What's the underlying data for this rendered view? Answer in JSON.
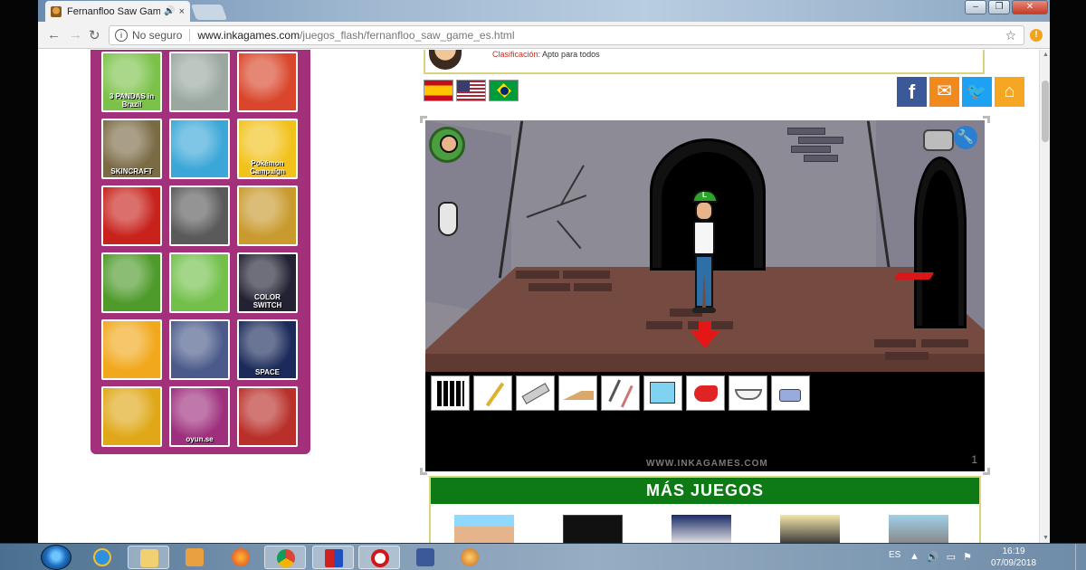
{
  "browser": {
    "tab_title": "Fernanfloo Saw Game",
    "tab_speaker": "🔊",
    "tab_close": "×",
    "security_label": "No seguro",
    "url_host": "www.inkagames.com",
    "url_path": "/juegos_flash/fernanfloo_saw_game_es.html",
    "ext_badge": "!"
  },
  "sidebar_games": [
    {
      "label": "3 PANDAS in Brazil",
      "color": "#7cc24a"
    },
    {
      "label": "",
      "color": "#9aa8a0"
    },
    {
      "label": "",
      "color": "#d9462b"
    },
    {
      "label": "SKINCRAFT",
      "color": "#7b6b45"
    },
    {
      "label": "",
      "color": "#3aa7d8"
    },
    {
      "label": "Pokémon Campaign",
      "color": "#f2c21c"
    },
    {
      "label": "",
      "color": "#c8221c"
    },
    {
      "label": "",
      "color": "#5a5a5a"
    },
    {
      "label": "",
      "color": "#c99a2e"
    },
    {
      "label": "",
      "color": "#4e9a2a"
    },
    {
      "label": "",
      "color": "#72c04a"
    },
    {
      "label": "COLOR SWITCH",
      "color": "#222233"
    },
    {
      "label": "",
      "color": "#f2a81c"
    },
    {
      "label": "",
      "color": "#4a5a8a"
    },
    {
      "label": "SPACE",
      "color": "#1b2a5a"
    },
    {
      "label": "",
      "color": "#e0a818"
    },
    {
      "label": "oyun.se",
      "color": "#9e2f7d"
    },
    {
      "label": "",
      "color": "#b9302a"
    }
  ],
  "info": {
    "key": "Clasificación:",
    "value": "Apto para todos"
  },
  "social": {
    "facebook": "f",
    "mail": "✉",
    "twitter": "🐦",
    "home": "⌂"
  },
  "game": {
    "watermark": "WWW.INKAGAMES.COM",
    "page_number": "1",
    "inventory_items": [
      "crossword-grid",
      "pencil",
      "cutter",
      "wood-wedge",
      "pliers",
      "blue-cloth",
      "whistle",
      "bowl",
      "oil-can"
    ]
  },
  "more_games": {
    "title": "MÁS JUEGOS"
  },
  "taskbar": {
    "language": "ES",
    "time": "16:19",
    "date": "07/09/2018"
  }
}
